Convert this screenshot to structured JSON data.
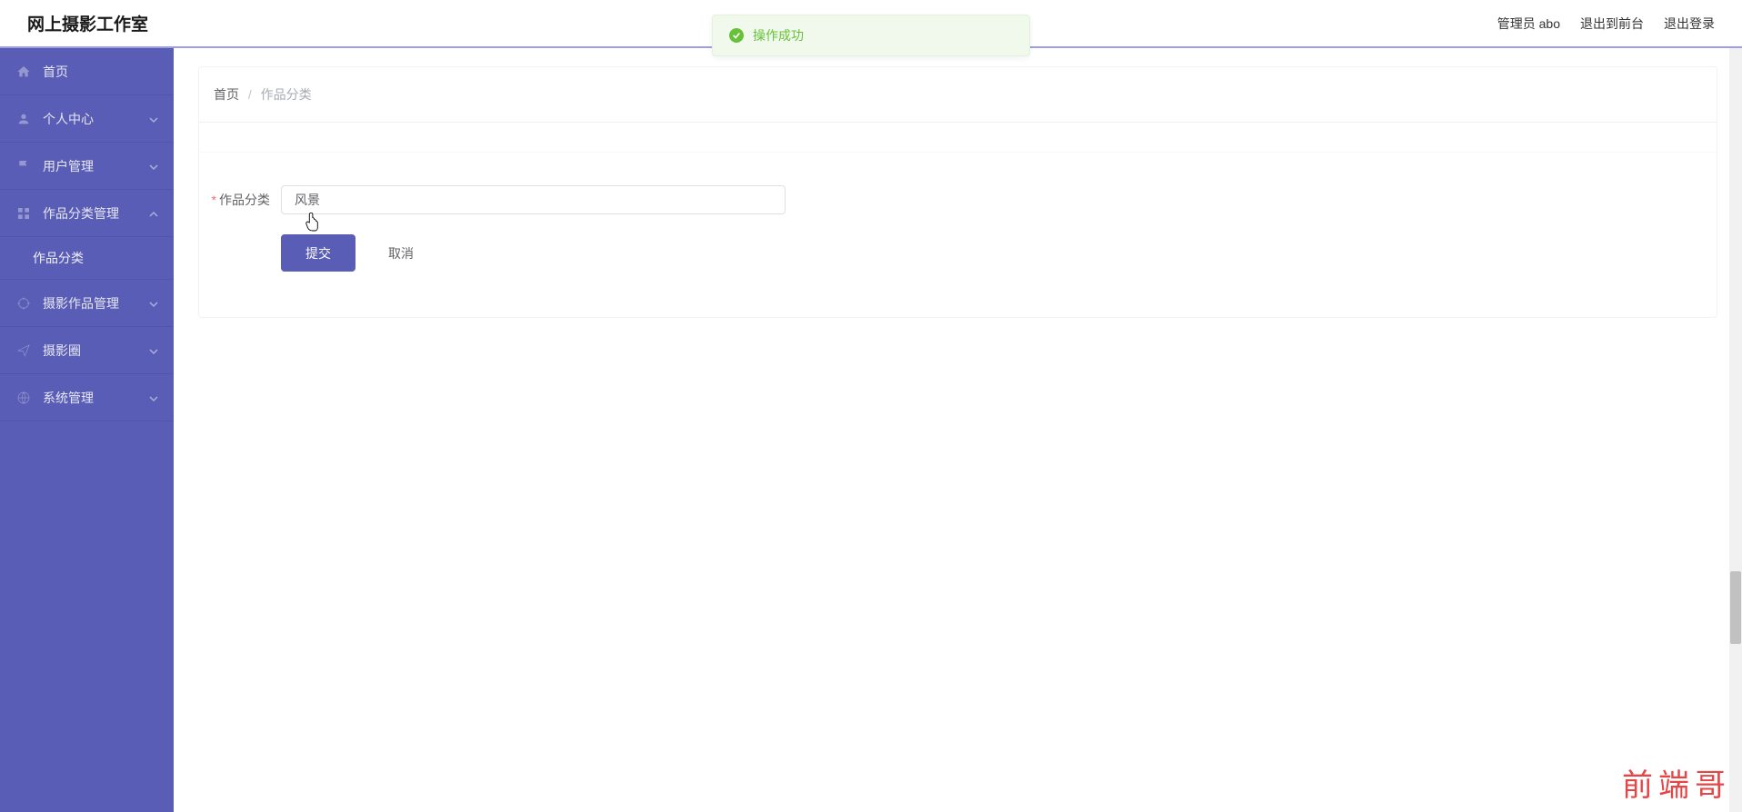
{
  "header": {
    "title": "网上摄影工作室",
    "links": {
      "admin": "管理员 abo",
      "logout_front": "退出到前台",
      "logout": "退出登录"
    }
  },
  "toast": {
    "message": "操作成功"
  },
  "sidebar": {
    "items": [
      {
        "label": "首页",
        "icon": "home-icon",
        "expandable": false
      },
      {
        "label": "个人中心",
        "icon": "person-icon",
        "expandable": true,
        "expanded": false
      },
      {
        "label": "用户管理",
        "icon": "flag-icon",
        "expandable": true,
        "expanded": false
      },
      {
        "label": "作品分类管理",
        "icon": "grid-icon",
        "expandable": true,
        "expanded": true,
        "children": [
          {
            "label": "作品分类"
          }
        ]
      },
      {
        "label": "摄影作品管理",
        "icon": "crosshair-icon",
        "expandable": true,
        "expanded": false
      },
      {
        "label": "摄影圈",
        "icon": "send-icon",
        "expandable": true,
        "expanded": false
      },
      {
        "label": "系统管理",
        "icon": "globe-icon",
        "expandable": true,
        "expanded": false
      }
    ]
  },
  "breadcrumb": {
    "home": "首页",
    "current": "作品分类"
  },
  "form": {
    "category_label": "作品分类",
    "category_value": "风景",
    "submit": "提交",
    "cancel": "取消"
  },
  "watermark": "前端哥"
}
